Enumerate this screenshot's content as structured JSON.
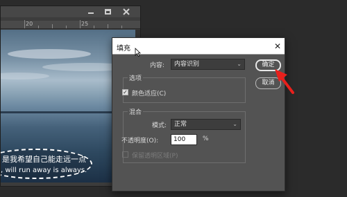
{
  "document": {
    "ruler_labels": [
      "20",
      "25"
    ],
    "caption_line1": "是我希望自己能走远一点",
    "caption_line2": ", will run away is always."
  },
  "fill_dialog": {
    "title": "填充",
    "contents_label": "内容:",
    "contents_value": "内容识别",
    "options_group": "选项",
    "color_adaptation_label": "颜色适应(C)",
    "color_adaptation_checked": true,
    "blending_group": "混合",
    "mode_label": "模式:",
    "mode_value": "正常",
    "opacity_label": "不透明度(O):",
    "opacity_value": "100",
    "opacity_unit": "%",
    "preserve_transparency_label": "保留透明区域(P)",
    "preserve_transparency_checked": false,
    "ok_label": "确定",
    "cancel_label": "取消",
    "close_glyph": "✕"
  },
  "colors": {
    "annotation_arrow": "#e8201c",
    "dialog_bg": "#535353"
  }
}
